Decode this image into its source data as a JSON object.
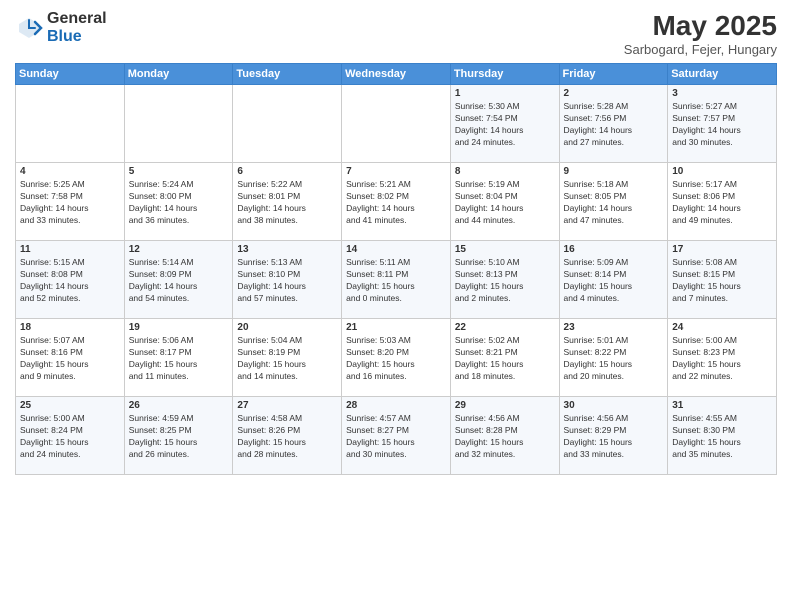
{
  "header": {
    "logo_general": "General",
    "logo_blue": "Blue",
    "month_year": "May 2025",
    "location": "Sarbogard, Fejer, Hungary"
  },
  "days_of_week": [
    "Sunday",
    "Monday",
    "Tuesday",
    "Wednesday",
    "Thursday",
    "Friday",
    "Saturday"
  ],
  "weeks": [
    [
      {
        "day": "",
        "content": ""
      },
      {
        "day": "",
        "content": ""
      },
      {
        "day": "",
        "content": ""
      },
      {
        "day": "",
        "content": ""
      },
      {
        "day": "1",
        "content": "Sunrise: 5:30 AM\nSunset: 7:54 PM\nDaylight: 14 hours\nand 24 minutes."
      },
      {
        "day": "2",
        "content": "Sunrise: 5:28 AM\nSunset: 7:56 PM\nDaylight: 14 hours\nand 27 minutes."
      },
      {
        "day": "3",
        "content": "Sunrise: 5:27 AM\nSunset: 7:57 PM\nDaylight: 14 hours\nand 30 minutes."
      }
    ],
    [
      {
        "day": "4",
        "content": "Sunrise: 5:25 AM\nSunset: 7:58 PM\nDaylight: 14 hours\nand 33 minutes."
      },
      {
        "day": "5",
        "content": "Sunrise: 5:24 AM\nSunset: 8:00 PM\nDaylight: 14 hours\nand 36 minutes."
      },
      {
        "day": "6",
        "content": "Sunrise: 5:22 AM\nSunset: 8:01 PM\nDaylight: 14 hours\nand 38 minutes."
      },
      {
        "day": "7",
        "content": "Sunrise: 5:21 AM\nSunset: 8:02 PM\nDaylight: 14 hours\nand 41 minutes."
      },
      {
        "day": "8",
        "content": "Sunrise: 5:19 AM\nSunset: 8:04 PM\nDaylight: 14 hours\nand 44 minutes."
      },
      {
        "day": "9",
        "content": "Sunrise: 5:18 AM\nSunset: 8:05 PM\nDaylight: 14 hours\nand 47 minutes."
      },
      {
        "day": "10",
        "content": "Sunrise: 5:17 AM\nSunset: 8:06 PM\nDaylight: 14 hours\nand 49 minutes."
      }
    ],
    [
      {
        "day": "11",
        "content": "Sunrise: 5:15 AM\nSunset: 8:08 PM\nDaylight: 14 hours\nand 52 minutes."
      },
      {
        "day": "12",
        "content": "Sunrise: 5:14 AM\nSunset: 8:09 PM\nDaylight: 14 hours\nand 54 minutes."
      },
      {
        "day": "13",
        "content": "Sunrise: 5:13 AM\nSunset: 8:10 PM\nDaylight: 14 hours\nand 57 minutes."
      },
      {
        "day": "14",
        "content": "Sunrise: 5:11 AM\nSunset: 8:11 PM\nDaylight: 15 hours\nand 0 minutes."
      },
      {
        "day": "15",
        "content": "Sunrise: 5:10 AM\nSunset: 8:13 PM\nDaylight: 15 hours\nand 2 minutes."
      },
      {
        "day": "16",
        "content": "Sunrise: 5:09 AM\nSunset: 8:14 PM\nDaylight: 15 hours\nand 4 minutes."
      },
      {
        "day": "17",
        "content": "Sunrise: 5:08 AM\nSunset: 8:15 PM\nDaylight: 15 hours\nand 7 minutes."
      }
    ],
    [
      {
        "day": "18",
        "content": "Sunrise: 5:07 AM\nSunset: 8:16 PM\nDaylight: 15 hours\nand 9 minutes."
      },
      {
        "day": "19",
        "content": "Sunrise: 5:06 AM\nSunset: 8:17 PM\nDaylight: 15 hours\nand 11 minutes."
      },
      {
        "day": "20",
        "content": "Sunrise: 5:04 AM\nSunset: 8:19 PM\nDaylight: 15 hours\nand 14 minutes."
      },
      {
        "day": "21",
        "content": "Sunrise: 5:03 AM\nSunset: 8:20 PM\nDaylight: 15 hours\nand 16 minutes."
      },
      {
        "day": "22",
        "content": "Sunrise: 5:02 AM\nSunset: 8:21 PM\nDaylight: 15 hours\nand 18 minutes."
      },
      {
        "day": "23",
        "content": "Sunrise: 5:01 AM\nSunset: 8:22 PM\nDaylight: 15 hours\nand 20 minutes."
      },
      {
        "day": "24",
        "content": "Sunrise: 5:00 AM\nSunset: 8:23 PM\nDaylight: 15 hours\nand 22 minutes."
      }
    ],
    [
      {
        "day": "25",
        "content": "Sunrise: 5:00 AM\nSunset: 8:24 PM\nDaylight: 15 hours\nand 24 minutes."
      },
      {
        "day": "26",
        "content": "Sunrise: 4:59 AM\nSunset: 8:25 PM\nDaylight: 15 hours\nand 26 minutes."
      },
      {
        "day": "27",
        "content": "Sunrise: 4:58 AM\nSunset: 8:26 PM\nDaylight: 15 hours\nand 28 minutes."
      },
      {
        "day": "28",
        "content": "Sunrise: 4:57 AM\nSunset: 8:27 PM\nDaylight: 15 hours\nand 30 minutes."
      },
      {
        "day": "29",
        "content": "Sunrise: 4:56 AM\nSunset: 8:28 PM\nDaylight: 15 hours\nand 32 minutes."
      },
      {
        "day": "30",
        "content": "Sunrise: 4:56 AM\nSunset: 8:29 PM\nDaylight: 15 hours\nand 33 minutes."
      },
      {
        "day": "31",
        "content": "Sunrise: 4:55 AM\nSunset: 8:30 PM\nDaylight: 15 hours\nand 35 minutes."
      }
    ]
  ]
}
